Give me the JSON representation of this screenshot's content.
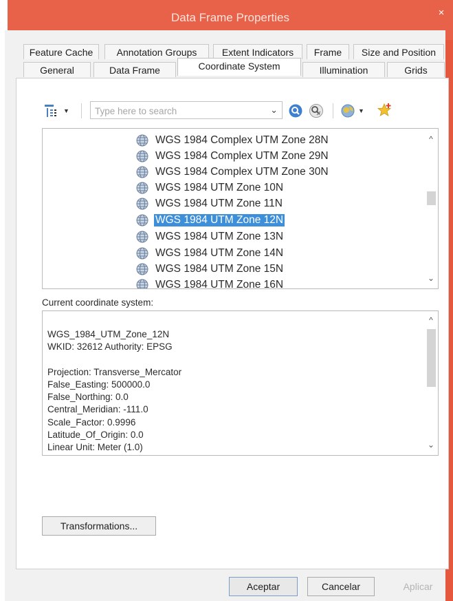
{
  "window": {
    "title": "Data Frame Properties",
    "close_glyph": "×"
  },
  "tabs_row1": [
    {
      "label": "Feature Cache"
    },
    {
      "label": "Annotation Groups"
    },
    {
      "label": "Extent Indicators"
    },
    {
      "label": "Frame"
    },
    {
      "label": "Size and Position"
    }
  ],
  "tabs_row2": [
    {
      "label": "General"
    },
    {
      "label": "Data Frame"
    },
    {
      "label": "Coordinate System",
      "active": true
    },
    {
      "label": "Illumination"
    },
    {
      "label": "Grids"
    }
  ],
  "toolbar": {
    "filter_icon": "filter-icon",
    "search": {
      "placeholder": "Type here to search",
      "value": ""
    },
    "search_icon": "search-icon",
    "clear_search_icon": "clear-search-icon",
    "globe_menu_icon": "globe-icon",
    "favorite_icon": "add-favorite-icon"
  },
  "coordinate_list": {
    "items": [
      {
        "label": "WGS 1984 Complex UTM Zone 28N"
      },
      {
        "label": "WGS 1984 Complex UTM Zone 29N"
      },
      {
        "label": "WGS 1984 Complex UTM Zone 30N"
      },
      {
        "label": "WGS 1984 UTM Zone 10N"
      },
      {
        "label": "WGS 1984 UTM Zone 11N"
      },
      {
        "label": "WGS 1984 UTM Zone 12N",
        "selected": true
      },
      {
        "label": "WGS 1984 UTM Zone 13N"
      },
      {
        "label": "WGS 1984 UTM Zone 14N"
      },
      {
        "label": "WGS 1984 UTM Zone 15N"
      },
      {
        "label": "WGS 1984 UTM Zone 16N"
      }
    ],
    "item_icon": "projected-coordinate-system-icon"
  },
  "current_system": {
    "label": "Current coordinate system:",
    "lines": [
      "WGS_1984_UTM_Zone_12N",
      "WKID: 32612 Authority: EPSG",
      "",
      "Projection: Transverse_Mercator",
      "False_Easting: 500000.0",
      "False_Northing: 0.0",
      "Central_Meridian: -111.0",
      "Scale_Factor: 0.9996",
      "Latitude_Of_Origin: 0.0",
      "Linear Unit: Meter (1.0)"
    ]
  },
  "buttons": {
    "transformations": "Transformations...",
    "ok": "Aceptar",
    "cancel": "Cancelar",
    "apply": "Aplicar"
  },
  "colors": {
    "title_bar": "#e8624a",
    "selection": "#3d8fd9"
  }
}
